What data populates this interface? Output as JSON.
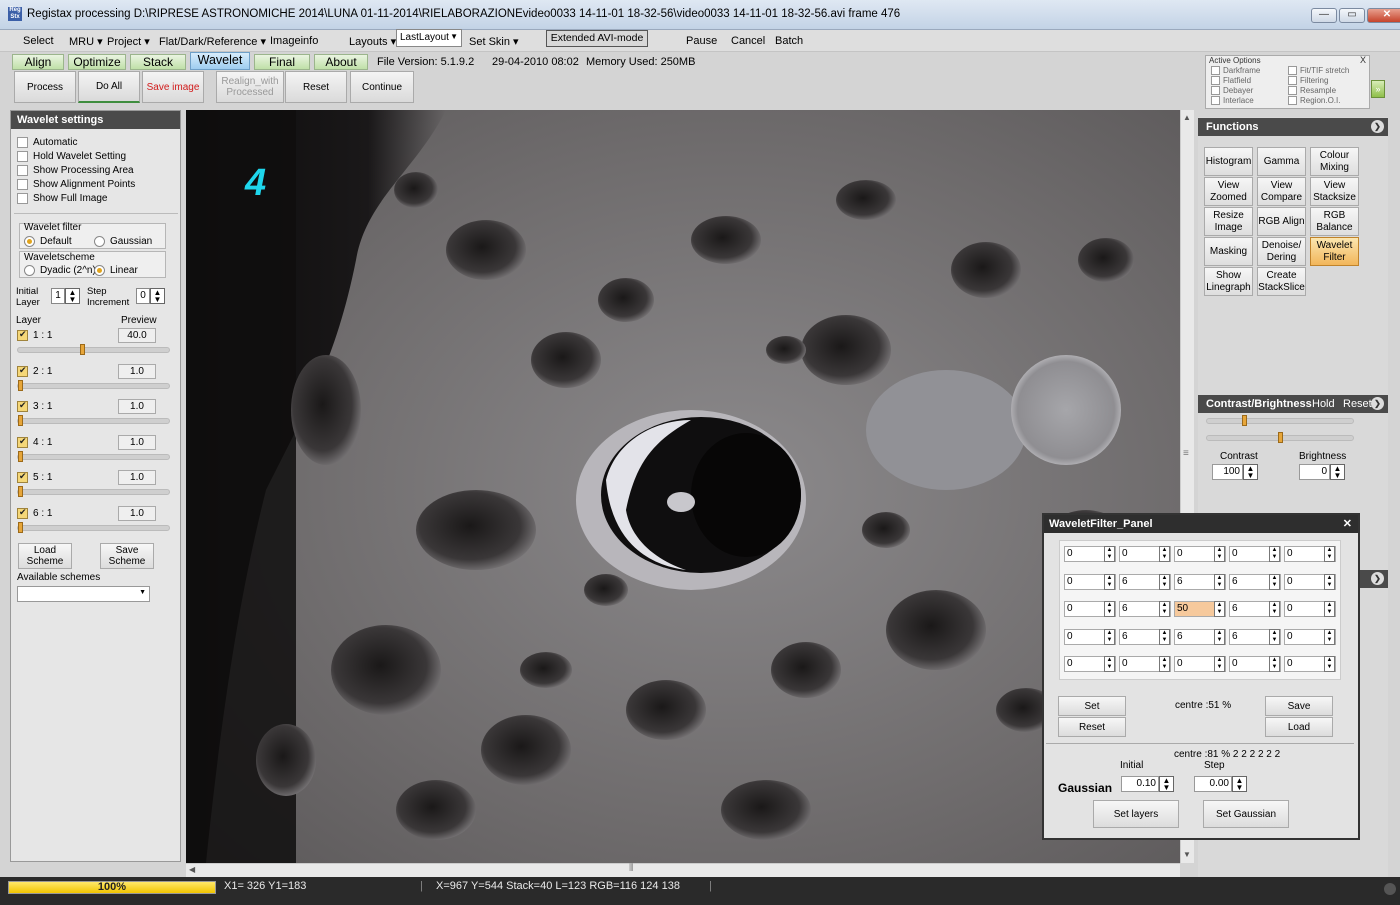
{
  "window": {
    "title": "Registax processing D:\\RIPRESE ASTRONOMICHE 2014\\LUNA 01-11-2014\\RIELABORAZIONEvideo0033 14-11-01 18-32-56\\video0033 14-11-01 18-32-56.avi frame 476",
    "app_icon_text": "Reg\nStx",
    "minimize": "—",
    "maximize": "▭",
    "close": "✕"
  },
  "menu": {
    "select": "Select",
    "mru": "MRU ▾",
    "project": "Project ▾",
    "flat": "Flat/Dark/Reference ▾",
    "imageinfo": "Imageinfo",
    "layouts": "Layouts ▾",
    "layout_value": "LastLayout",
    "set_skin": "Set Skin ▾",
    "extended": "Extended AVI-mode",
    "pause": "Pause",
    "cancel": "Cancel",
    "batch": "Batch"
  },
  "tabs": [
    "Align",
    "Optimize",
    "Stack",
    "Wavelet",
    "Final",
    "About"
  ],
  "info": {
    "version": "File Version: 5.1.9.2",
    "date": "29-04-2010 08:02",
    "memory": "Memory Used: 250MB"
  },
  "toolbar": {
    "process": "Process",
    "do_all": "Do All",
    "save_image": "Save image",
    "realign": "Realign_with Processed",
    "reset": "Reset",
    "continue": "Continue"
  },
  "active_options": {
    "title": "Active Options",
    "close": "X",
    "left": [
      "Darkframe",
      "Flatfield",
      "Debayer",
      "Interlace"
    ],
    "right": [
      "Fit/TIF stretch",
      "Filtering",
      "Resample",
      "Region.O.I."
    ],
    "expand": "»"
  },
  "wavelet_settings": {
    "title": "Wavelet settings",
    "options": [
      "Automatic",
      "Hold Wavelet Setting",
      "Show Processing Area",
      "Show Alignment Points",
      "Show Full Image"
    ],
    "filter_label": "Wavelet filter",
    "filter_default": "Default",
    "filter_gaussian": "Gaussian",
    "scheme_label": "Waveletscheme",
    "scheme_dyadic": "Dyadic (2^n)",
    "scheme_linear": "Linear",
    "initial_layer_label": "Initial Layer",
    "initial_layer_value": "1",
    "step_increment_label": "Step Increment",
    "step_increment_value": "0",
    "layer_header": "Layer",
    "preview_header": "Preview",
    "layers": [
      {
        "name": "1 : 1",
        "value": "40.0",
        "level": 0.42
      },
      {
        "name": "2 : 1",
        "value": "1.0",
        "level": 0.0
      },
      {
        "name": "3 : 1",
        "value": "1.0",
        "level": 0.0
      },
      {
        "name": "4 : 1",
        "value": "1.0",
        "level": 0.0
      },
      {
        "name": "5 : 1",
        "value": "1.0",
        "level": 0.0
      },
      {
        "name": "6 : 1",
        "value": "1.0",
        "level": 0.0
      }
    ],
    "load_scheme": "Load Scheme",
    "save_scheme": "Save Scheme",
    "available_schemes": "Available schemes",
    "scheme_select_value": ""
  },
  "image": {
    "overlay_number": "4"
  },
  "functions": {
    "title": "Functions",
    "buttons": [
      "Histogram",
      "Gamma",
      "Colour Mixing",
      "View Zoomed",
      "View Compare",
      "View Stacksize",
      "Resize Image",
      "RGB Align",
      "RGB Balance",
      "Masking",
      "Denoise/ Dering",
      "Wavelet Filter",
      "Show Linegraph",
      "Create StackSlice"
    ],
    "active": "Wavelet Filter"
  },
  "contrast_brightness": {
    "title": "Contrast/Brightness",
    "hold": "Hold",
    "reset": "Reset",
    "contrast_label": "Contrast",
    "contrast_value": "100",
    "brightness_label": "Brightness",
    "brightness_value": "0"
  },
  "wavelet_filter_panel": {
    "title": "WaveletFilter_Panel",
    "close": "✕",
    "grid": [
      [
        "0",
        "0",
        "0",
        "0",
        "0"
      ],
      [
        "0",
        "6",
        "6",
        "6",
        "0"
      ],
      [
        "0",
        "6",
        "50",
        "6",
        "0"
      ],
      [
        "0",
        "6",
        "6",
        "6",
        "0"
      ],
      [
        "0",
        "0",
        "0",
        "0",
        "0"
      ]
    ],
    "set": "Set",
    "reset": "Reset",
    "centre": "centre :51 %",
    "save": "Save",
    "load": "Load",
    "centre2": "centre :81 % 2 2 2 2 2 2",
    "initial_label": "Initial",
    "step_label": "Step",
    "gaussian_label": "Gaussian",
    "initial_value": "0.10",
    "step_value": "0.00",
    "set_layers": "Set layers",
    "set_gaussian": "Set Gaussian"
  },
  "status": {
    "progress": "100%",
    "progress_level": 1.0,
    "coords1": "X1= 326 Y1=183",
    "coords2": "X=967 Y=544 Stack=40 L=123 RGB=116 124 138"
  }
}
